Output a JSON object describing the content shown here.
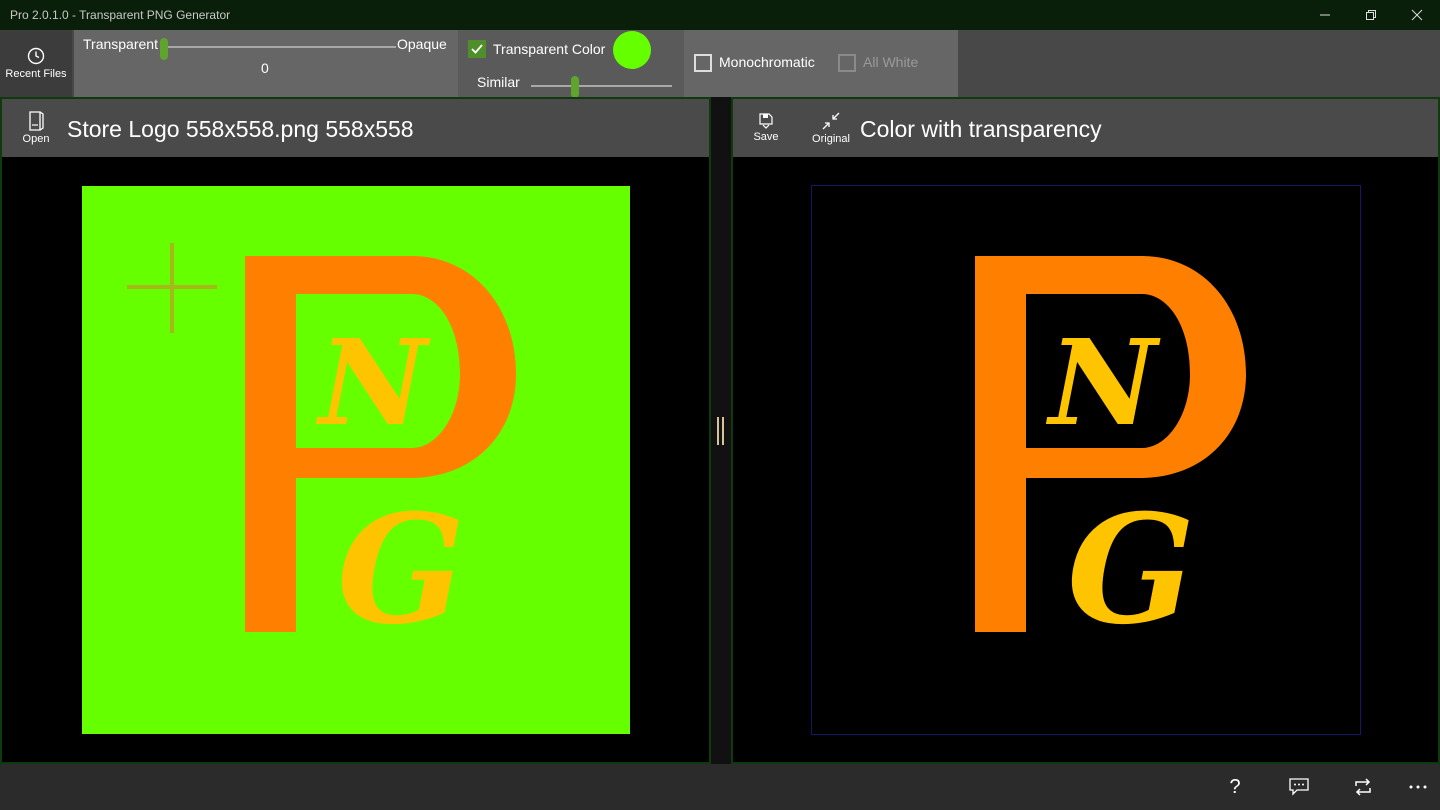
{
  "window": {
    "title": "Pro 2.0.1.0 - Transparent PNG Generator"
  },
  "toolbar": {
    "recent_files_label": "Recent Files",
    "transparency": {
      "left_label": "Transparent",
      "right_label": "Opaque",
      "value": "0",
      "slider_fraction": 0.0
    },
    "transparent_color": {
      "label": "Transparent Color",
      "checked": true,
      "color": "#66ff00"
    },
    "similar": {
      "label": "Similar",
      "slider_fraction": 0.3
    },
    "monochromatic": {
      "label": "Monochromatic",
      "checked": false
    },
    "all_white": {
      "label": "All White",
      "checked": false,
      "enabled": false
    }
  },
  "left_pane": {
    "open_label": "Open",
    "title": "Store Logo 558x558.png 558x558"
  },
  "right_pane": {
    "save_label": "Save",
    "original_label": "Original",
    "title": "Color with transparency"
  },
  "bottom_bar": {
    "help_icon": "question-mark-icon",
    "feedback_icon": "feedback-icon",
    "repeat_icon": "repeat-icon",
    "more_icon": "more-icon"
  },
  "colors": {
    "accent": "#5fa52d",
    "logo_green": "#66ff00",
    "logo_orange": "#ff7f00",
    "logo_yellow": "#ffc400"
  }
}
